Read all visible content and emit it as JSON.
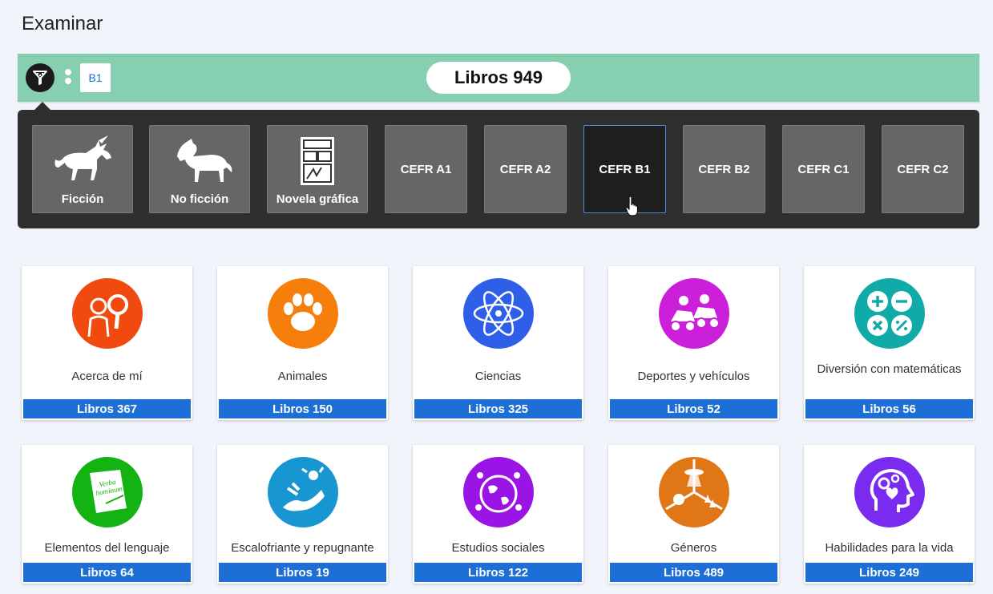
{
  "page": {
    "title": "Examinar"
  },
  "filter_bar": {
    "active_chip": "B1",
    "total_label": "Libros 949",
    "background": "#86cfb1"
  },
  "filter_panel": {
    "options": [
      {
        "label": "Ficción",
        "icon": "unicorn-icon"
      },
      {
        "label": "No ficción",
        "icon": "horse-icon"
      },
      {
        "label": "Novela gráfica",
        "icon": "comic-icon"
      },
      {
        "label": "CEFR A1"
      },
      {
        "label": "CEFR A2"
      },
      {
        "label": "CEFR B1",
        "selected": true
      },
      {
        "label": "CEFR B2"
      },
      {
        "label": "CEFR C1"
      },
      {
        "label": "CEFR C2"
      }
    ]
  },
  "categories": [
    {
      "label": "Acerca de mí",
      "count": "Libros 367",
      "color": "#f04a0e",
      "icon": "person-magnifier-icon"
    },
    {
      "label": "Animales",
      "count": "Libros 150",
      "color": "#f57f0a",
      "icon": "paw-icon"
    },
    {
      "label": "Ciencias",
      "count": "Libros 325",
      "color": "#2f5ee8",
      "icon": "atom-icon"
    },
    {
      "label": "Deportes y vehículos",
      "count": "Libros 52",
      "color": "#cc1fd9",
      "icon": "go-kart-icon"
    },
    {
      "label": "Diversión con matemáticas",
      "count": "Libros 56",
      "color": "#10aaa9",
      "icon": "math-operators-icon"
    },
    {
      "label": "Elementos del lenguaje",
      "count": "Libros 64",
      "color": "#12b312",
      "icon": "scroll-quill-icon"
    },
    {
      "label": "Escalofriante y repugnante",
      "count": "Libros 19",
      "color": "#1796d2",
      "icon": "monster-icon"
    },
    {
      "label": "Estudios sociales",
      "count": "Libros 122",
      "color": "#9b14e6",
      "icon": "globe-people-icon"
    },
    {
      "label": "Géneros",
      "count": "Libros 489",
      "color": "#e07615",
      "icon": "genres-icon"
    },
    {
      "label": "Habilidades para la vida",
      "count": "Libros 249",
      "color": "#7a2bf0",
      "icon": "head-gear-heart-icon"
    }
  ],
  "colors": {
    "count_bar": "#1d6fd6",
    "panel": "#2f2f2f",
    "selected_border": "#4b8fd8"
  }
}
